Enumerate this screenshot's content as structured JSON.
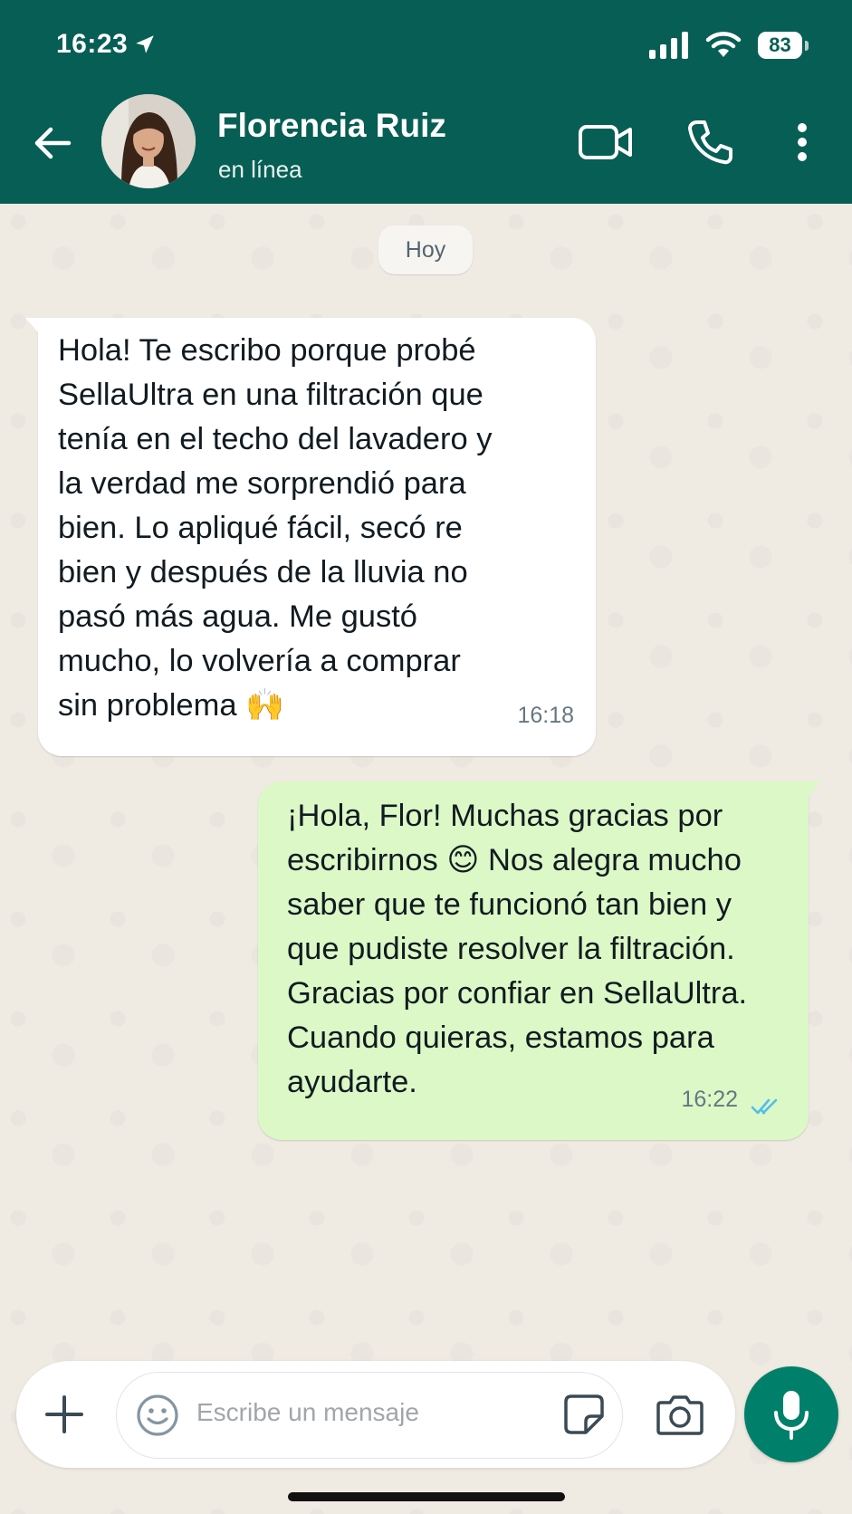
{
  "status_bar": {
    "time": "16:23",
    "battery": "83"
  },
  "header": {
    "contact_name": "Florencia Ruiz",
    "contact_status": "en línea",
    "icons": [
      "back-arrow-icon",
      "video-call-icon",
      "phone-icon",
      "more-vert-icon"
    ]
  },
  "chat": {
    "date_label": "Hoy",
    "messages": [
      {
        "direction": "incoming",
        "text": "Hola! Te escribo porque probé\nSellaUltra en una filtración que\ntenía en el techo del lavadero y\nla verdad me sorprendió para\nbien. Lo apliqué fácil, secó re\nbien y después de la lluvia no\npasó más agua. Me gustó\nmucho, lo volvería a comprar\nsin problema 🙌",
        "time": "16:18"
      },
      {
        "direction": "outgoing",
        "text": "¡Hola, Flor! Muchas gracias por\nescribirnos 😊 Nos alegra mucho\nsaber que te funcionó tan bien y\nque pudiste resolver la filtración.\nGracias por confiar en SellaUltra.\nCuando quieras, estamos para\nayudarte.",
        "time": "16:22",
        "status": "read"
      }
    ]
  },
  "composer": {
    "placeholder": "Escribe un mensaje"
  },
  "colors": {
    "header": "#075e54",
    "outgoing_bubble": "#dcf8c6",
    "incoming_bubble": "#ffffff",
    "chat_background": "#efeae2",
    "mic_button": "#00806a",
    "read_ticks": "#53bdeb"
  }
}
